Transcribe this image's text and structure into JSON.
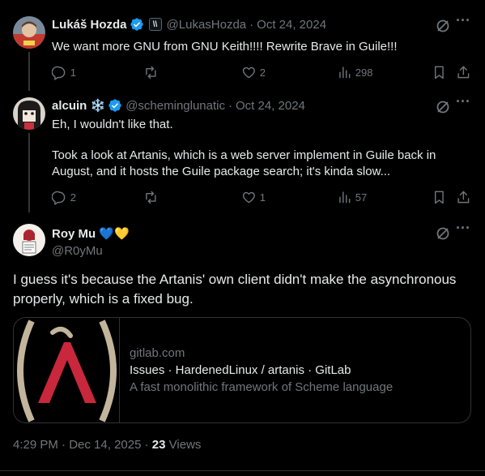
{
  "posts": [
    {
      "name": "Lukáš Hozda",
      "handle": "@LukasHozda",
      "sep": "·",
      "date": "Oct 24, 2024",
      "badge_text": "\\\\",
      "text": "We want more GNU from GNU Keith!!!! Rewrite Brave in Guile!!!",
      "replies": "1",
      "reposts": "",
      "likes": "2",
      "views": "298"
    },
    {
      "name": "alcuin ❄️",
      "handle": "@scheminglunatic",
      "sep": "·",
      "date": "Oct 24, 2024",
      "text_line1": "Eh, I wouldn't like that.",
      "text_line2": "Took a look at Artanis, which is a web server implement in Guile back in August, and it hosts the Guile package search; it's kinda slow...",
      "replies": "2",
      "reposts": "",
      "likes": "1",
      "views": "57"
    }
  ],
  "main": {
    "name": "Roy Mu 💙💛",
    "handle": "@R0yMu",
    "text": "I guess it's because the Artanis' own client didn't make the asynchronous properly, which is a fixed bug.",
    "card": {
      "domain": "gitlab.com",
      "title": "Issues · HardenedLinux / artanis · GitLab",
      "description": "A fast monolithic framework of Scheme language"
    },
    "time": "4:29 PM",
    "date": "Dec 14, 2025",
    "views_count": "23",
    "views_label": "Views"
  },
  "icons": {
    "reply": "reply-icon",
    "repost": "repost-icon",
    "like": "heart-icon",
    "views": "views-icon",
    "bookmark": "bookmark-icon",
    "share": "share-icon",
    "grok": "grok-icon",
    "more": "more-icon",
    "verified": "verified-icon"
  },
  "colors": {
    "background": "#000000",
    "text": "#e7e9ea",
    "muted": "#71767b",
    "verified": "#1d9bf0",
    "border": "#2f3336",
    "artanis_red": "#c8273c",
    "artanis_tan": "#c2b59b"
  }
}
